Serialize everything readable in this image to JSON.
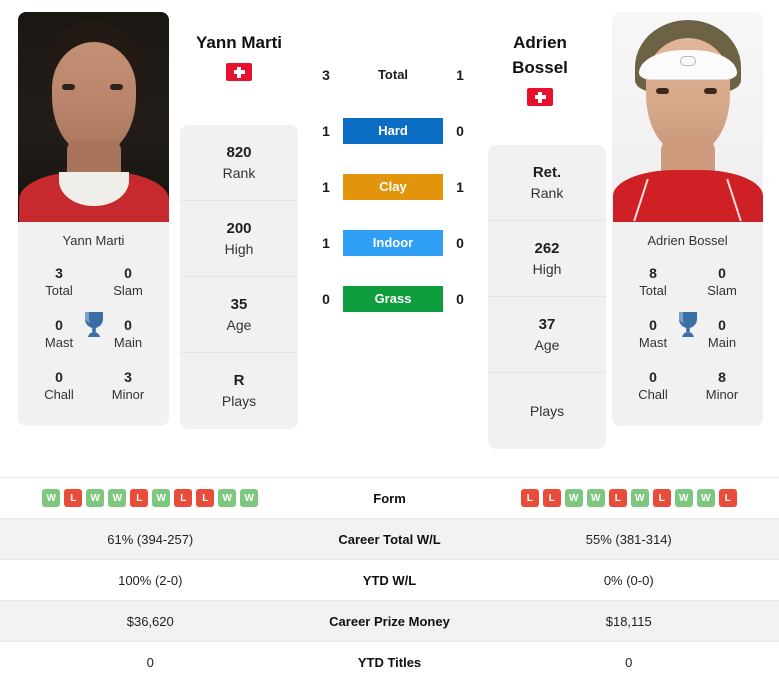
{
  "players": {
    "left": {
      "name": "Yann Marti",
      "photo_caption": "Yann Marti",
      "flag": "swiss-flag",
      "stats": [
        {
          "value": "820",
          "label": "Rank"
        },
        {
          "value": "200",
          "label": "High"
        },
        {
          "value": "35",
          "label": "Age"
        },
        {
          "value": "R",
          "label": "Plays"
        }
      ],
      "titles": [
        {
          "value": "3",
          "label": "Total"
        },
        {
          "value": "0",
          "label": "Slam"
        },
        {
          "value": "0",
          "label": "Mast"
        },
        {
          "value": "0",
          "label": "Main"
        },
        {
          "value": "0",
          "label": "Chall"
        },
        {
          "value": "3",
          "label": "Minor"
        }
      ],
      "form": [
        "W",
        "L",
        "W",
        "W",
        "L",
        "W",
        "L",
        "L",
        "W",
        "W"
      ]
    },
    "right": {
      "name": "Adrien Bossel",
      "name_line1": "Adrien",
      "name_line2": "Bossel",
      "photo_caption": "Adrien Bossel",
      "flag": "swiss-flag",
      "stats": [
        {
          "value": "Ret.",
          "label": "Rank"
        },
        {
          "value": "262",
          "label": "High"
        },
        {
          "value": "37",
          "label": "Age"
        },
        {
          "value": "",
          "label": "Plays"
        }
      ],
      "titles": [
        {
          "value": "8",
          "label": "Total"
        },
        {
          "value": "0",
          "label": "Slam"
        },
        {
          "value": "0",
          "label": "Mast"
        },
        {
          "value": "0",
          "label": "Main"
        },
        {
          "value": "0",
          "label": "Chall"
        },
        {
          "value": "8",
          "label": "Minor"
        }
      ],
      "form": [
        "L",
        "L",
        "W",
        "W",
        "L",
        "W",
        "L",
        "W",
        "W",
        "L"
      ]
    }
  },
  "head_to_head": [
    {
      "label": "Total",
      "left": "3",
      "right": "1",
      "color": ""
    },
    {
      "label": "Hard",
      "left": "1",
      "right": "0",
      "color": "#0b6dc4"
    },
    {
      "label": "Clay",
      "left": "1",
      "right": "1",
      "color": "#e2950c"
    },
    {
      "label": "Indoor",
      "left": "1",
      "right": "0",
      "color": "#2f9ff5"
    },
    {
      "label": "Grass",
      "left": "0",
      "right": "0",
      "color": "#0f9e3e"
    }
  ],
  "comparison_rows": [
    {
      "label": "Form",
      "left": "",
      "right": "",
      "type": "form"
    },
    {
      "label": "Career Total W/L",
      "left": "61% (394-257)",
      "right": "55% (381-314)",
      "type": "text"
    },
    {
      "label": "YTD W/L",
      "left": "100% (2-0)",
      "right": "0% (0-0)",
      "type": "text"
    },
    {
      "label": "Career Prize Money",
      "left": "$36,620",
      "right": "$18,115",
      "type": "text"
    },
    {
      "label": "YTD Titles",
      "left": "0",
      "right": "0",
      "type": "text"
    }
  ],
  "colors": {
    "hard": "#0b6dc4",
    "clay": "#e2950c",
    "indoor": "#2f9ff5",
    "grass": "#0f9e3e",
    "win_badge": "#7ec77e",
    "loss_badge": "#ea4c3a",
    "trophy": "#3a6ea5",
    "flag_red": "#e8112d"
  }
}
